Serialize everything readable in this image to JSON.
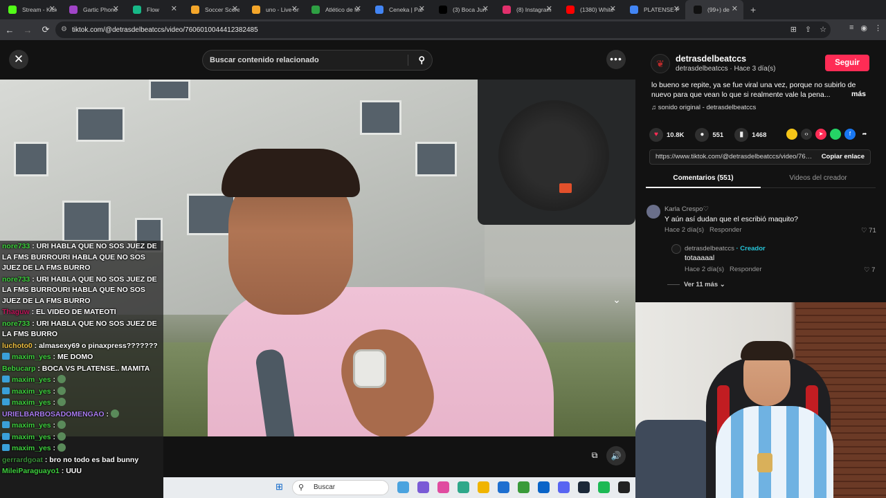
{
  "browser": {
    "tabs": [
      {
        "label": "Stream - Kick",
        "icon": "kick-icon",
        "color": "#53fc18"
      },
      {
        "label": "Gartic Phone",
        "icon": "gartic-icon",
        "color": "#a044c7"
      },
      {
        "label": "Flow",
        "icon": "flow-icon",
        "color": "#17b887"
      },
      {
        "label": "Soccer Score",
        "icon": "soccer-icon",
        "color": "#f4a62a"
      },
      {
        "label": "uno - Live on",
        "icon": "uno-icon",
        "color": "#f4a62a"
      },
      {
        "label": "Atlético de M",
        "icon": "atm-icon",
        "color": "#2ea043"
      },
      {
        "label": "Ceneka | Par",
        "icon": "chrome-icon",
        "color": "#4285f4"
      },
      {
        "label": "(3) Boca Jun",
        "icon": "x-icon",
        "color": "#000000"
      },
      {
        "label": "(8) Instagram",
        "icon": "instagram-icon",
        "color": "#e1306c"
      },
      {
        "label": "(1380) White",
        "icon": "youtube-icon",
        "color": "#ff0000"
      },
      {
        "label": "PLATENSE P",
        "icon": "google-icon",
        "color": "#4285f4"
      },
      {
        "label": "(99+) de",
        "icon": "tiktok-icon",
        "color": "#111111"
      }
    ],
    "new_tab": "+",
    "url": "tiktok.com/@detrasdelbeatccs/video/7606010044412382485"
  },
  "video": {
    "search_placeholder": "Buscar contenido relacionado",
    "close": "✕",
    "more": "•••"
  },
  "chat": [
    {
      "user": "nore733",
      "text": "URI HABLA QUE NO SOS JUEZ DE LA FMS BURROURI HABLA QUE NO SOS JUEZ DE LA FMS BURRO",
      "color": "#3ed13e",
      "badge": false
    },
    {
      "user": "nore733",
      "text": "URI HABLA QUE NO SOS JUEZ DE LA FMS BURROURI HABLA QUE NO SOS JUEZ DE LA FMS BURRO",
      "color": "#3ed13e",
      "badge": false
    },
    {
      "user": "Thaguw",
      "text": "EL VIDEO DE MATEOTI",
      "color": "#c2185b",
      "badge": false
    },
    {
      "user": "nore733",
      "text": "URI HABLA QUE NO SOS JUEZ DE LA FMS BURRO",
      "color": "#3ed13e",
      "badge": false
    },
    {
      "user": "luchoto0",
      "text": "almasexy69 o pinaxpress???????",
      "color": "#f0c040",
      "badge": false
    },
    {
      "user": "maxim_yes",
      "text": "ME DOMO",
      "color": "#3ed13e",
      "badge": true
    },
    {
      "user": "Bebucarp",
      "text": "BOCA VS PLATENSE.. MAMITA",
      "color": "#3ed13e",
      "badge": false
    },
    {
      "user": "maxim_yes",
      "text": "",
      "color": "#3ed13e",
      "badge": true
    },
    {
      "user": "maxim_yes",
      "text": "",
      "color": "#3ed13e",
      "badge": true
    },
    {
      "user": "maxim_yes",
      "text": "",
      "color": "#3ed13e",
      "badge": true
    },
    {
      "user": "URIELBARBOSADOMENGAO",
      "text": "",
      "color": "#a97cf0",
      "badge": false
    },
    {
      "user": "maxim_yes",
      "text": "",
      "color": "#3ed13e",
      "badge": true
    },
    {
      "user": "maxim_yes",
      "text": "",
      "color": "#3ed13e",
      "badge": true
    },
    {
      "user": "maxim_yes",
      "text": "",
      "color": "#3ed13e",
      "badge": true
    },
    {
      "user": "gerrardgoat",
      "text": "bro no todo es bad bunny",
      "color": "#3a8f3a",
      "badge": false
    },
    {
      "user": "MileiParaguayo1",
      "text": "UUU",
      "color": "#3ed13e",
      "badge": false
    }
  ],
  "taskbar": {
    "search_label": "Buscar",
    "apps": [
      "#4aa3df",
      "#7a5bd6",
      "#e04ca0",
      "#2ea88a",
      "#f0b400",
      "#1e6fd0",
      "#3a9b3a",
      "#0a64c8",
      "#5865f2",
      "#1b2838",
      "#1db954",
      "#222222"
    ]
  },
  "post": {
    "username": "detrasdelbeatccs",
    "subline": "detrasdelbeatccs · Hace 3 día(s)",
    "follow_label": "Seguir",
    "description": "lo bueno se repite, ya se fue viral una vez, porque no subirlo de nuevo para que vean lo que si realmente vale la pena...",
    "more_label": "más",
    "sound": "sonido original - detrasdelbeatccs",
    "likes": "10.8K",
    "comments": "551",
    "saves": "1468",
    "link": "https://www.tiktok.com/@detrasdelbeatccs/video/7606010044412382485",
    "copy_label": "Copiar enlace",
    "tab_comments": "Comentarios (551)",
    "tab_videos": "Videos del creador"
  },
  "comments": [
    {
      "name": "Karla Crespo♡",
      "text": "Y aún así dudan que el escribió maquito?",
      "time": "Hace 2 día(s)",
      "reply": "Responder",
      "likes": "71"
    },
    {
      "name": "detrasdelbeatccs",
      "creator": "· Creador",
      "text": "totaaaaal",
      "time": "Hace 2 día(s)",
      "reply": "Responder",
      "likes": "7"
    }
  ],
  "view_more": "Ver 11 más"
}
